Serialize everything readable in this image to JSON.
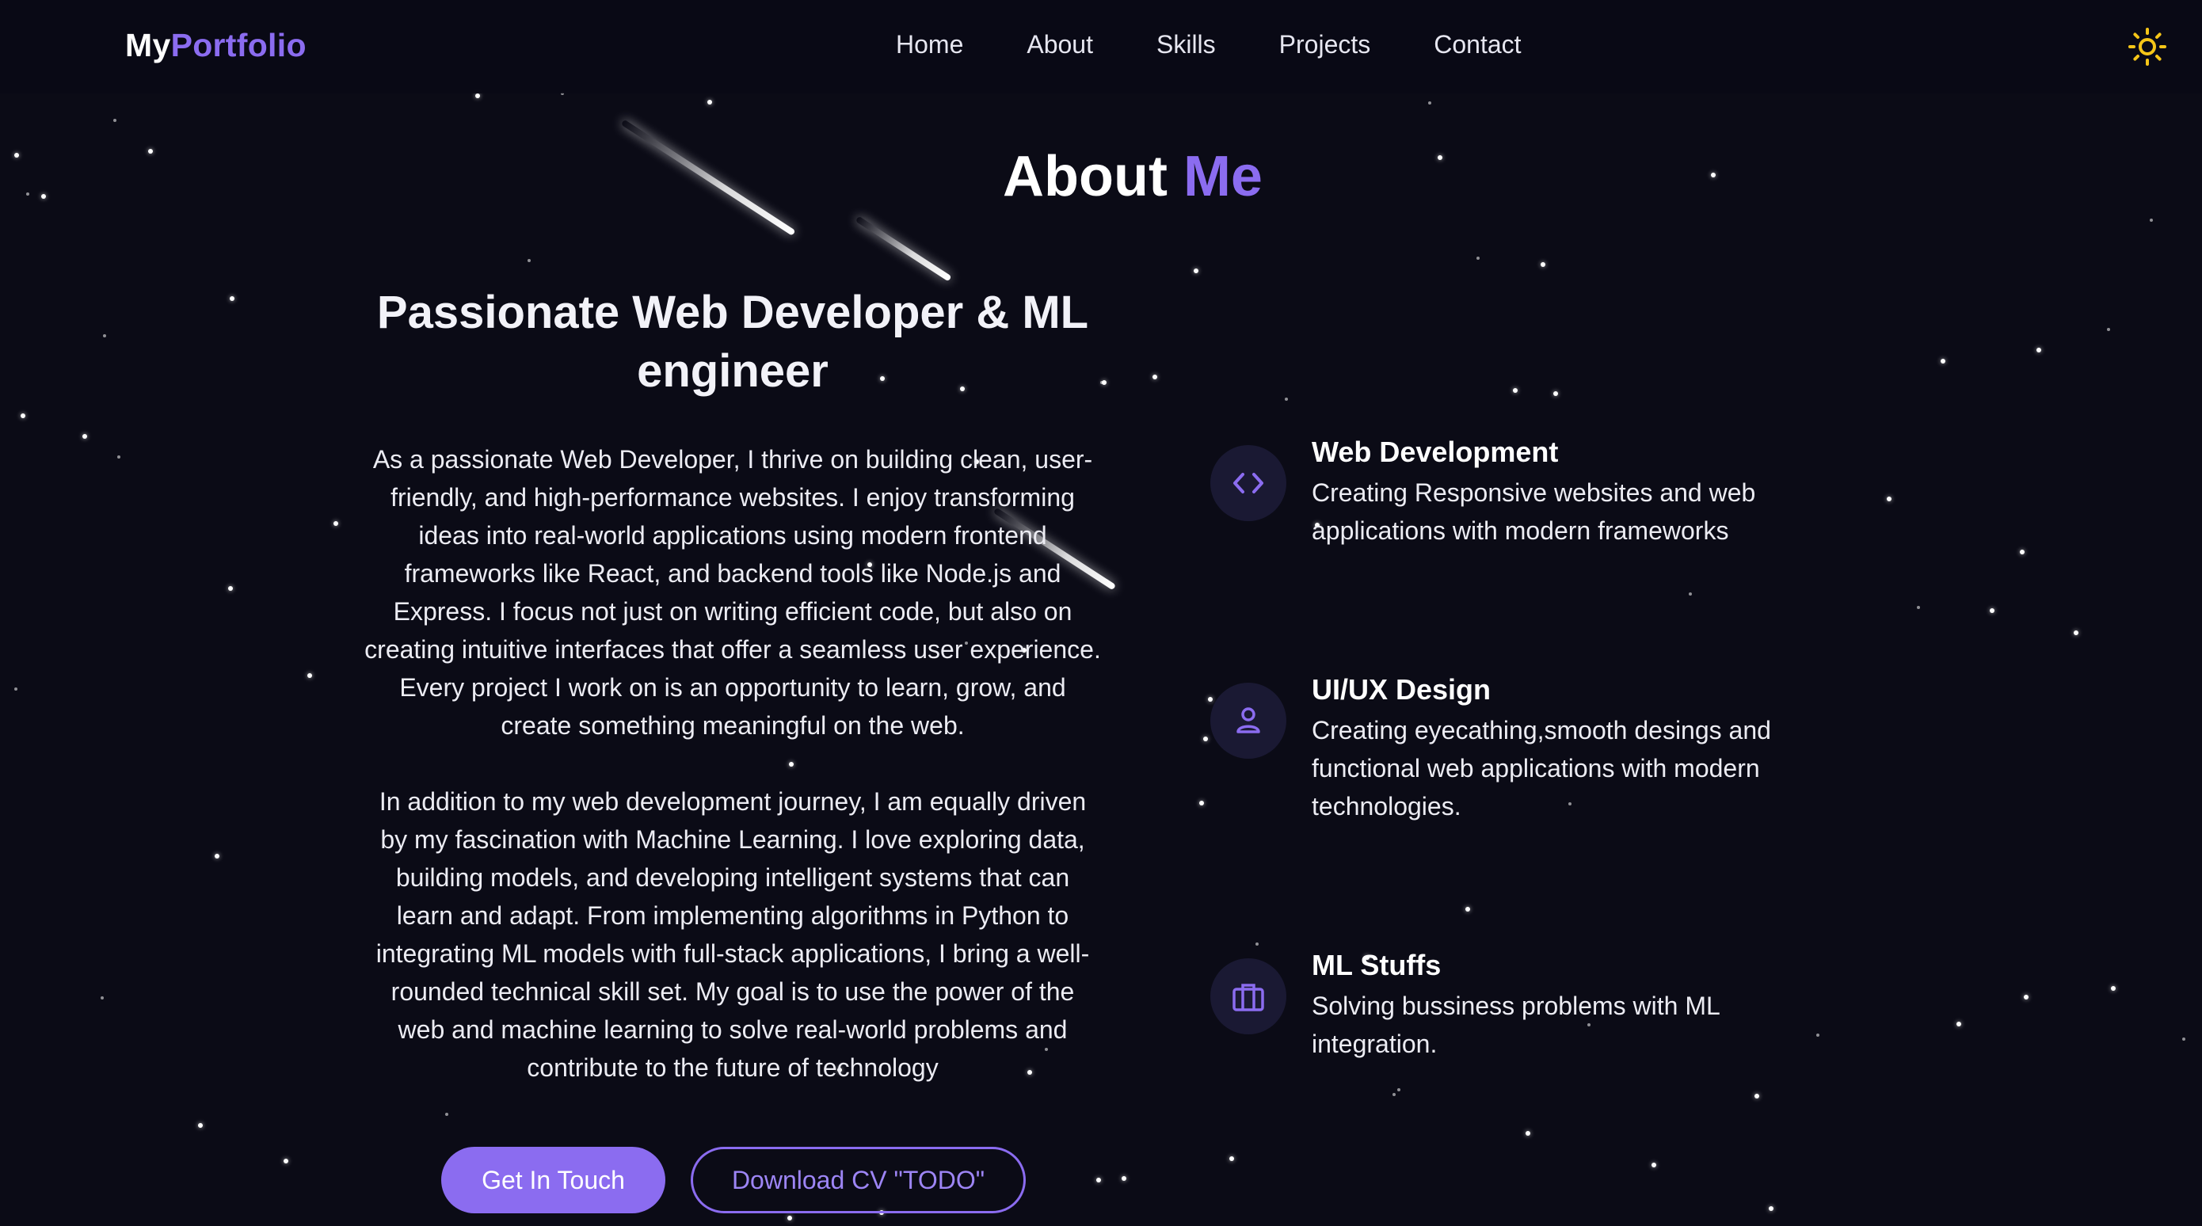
{
  "navbar": {
    "logo_prefix": "My",
    "logo_accent": "Portfolio",
    "links": [
      "Home",
      "About",
      "Skills",
      "Projects",
      "Contact"
    ],
    "theme_icon": "sun-icon"
  },
  "about": {
    "title_prefix": "About",
    "title_accent": "Me",
    "headline": "Passionate Web Developer & ML engineer",
    "paragraph_1": "As a passionate Web Developer, I thrive on building clean, user-friendly, and high-performance websites. I enjoy transforming ideas into real-world applications using modern frontend frameworks like React, and backend tools like Node.js and Express. I focus not just on writing efficient code, but also on creating intuitive interfaces that offer a seamless user experience. Every project I work on is an opportunity to learn, grow, and create something meaningful on the web.",
    "paragraph_2": "In addition to my web development journey, I am equally driven by my fascination with Machine Learning. I love exploring data, building models, and developing intelligent systems that can learn and adapt. From implementing algorithms in Python to integrating ML models with full-stack applications, I bring a well-rounded technical skill set. My goal is to use the power of the web and machine learning to solve real-world problems and contribute to the future of technology",
    "primary_button": "Get In Touch",
    "secondary_button": "Download CV \"TODO\""
  },
  "features": [
    {
      "icon": "code-icon",
      "title": "Web Development",
      "description": "Creating Responsive websites and web applications with modern frameworks"
    },
    {
      "icon": "user-icon",
      "title": "UI/UX Design",
      "description": "Creating eyecathing,smooth desings and functional web applications with modern technologies."
    },
    {
      "icon": "briefcase-icon",
      "title": "ML Stuffs",
      "description": "Solving bussiness problems with ML integration."
    }
  ],
  "colors": {
    "background": "#0b0b16",
    "accent": "#8b6cf0",
    "icon_circle": "#1a1933",
    "sun": "#f5c518"
  }
}
